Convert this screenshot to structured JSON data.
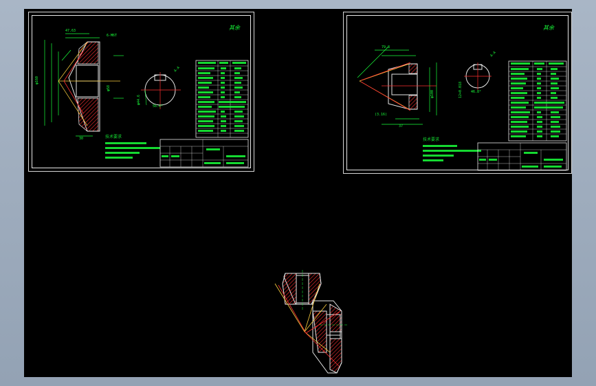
{
  "sheets": [
    {
      "name": "gear-drawing-1",
      "stamp": "其余",
      "technical_requirements_title": "技术要求"
    },
    {
      "name": "gear-drawing-2",
      "stamp": "其余",
      "technical_requirements_title": "技术要求"
    }
  ],
  "colors": {
    "background": "#000000",
    "cad_text": "#19ff3a",
    "hatch": "#ff3030",
    "center_line": "#ffd040",
    "outline": "#e8e8e8",
    "dimension": "#19ff3a",
    "window_frame": "#a9b6c6"
  }
}
